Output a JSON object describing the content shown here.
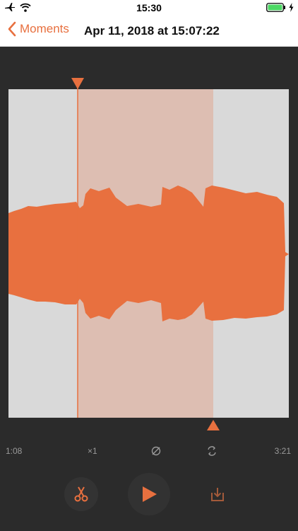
{
  "status": {
    "time": "15:30"
  },
  "nav": {
    "back_label": "Moments",
    "title": "Apr 11, 2018 at 15:07:22"
  },
  "toolbar": {
    "start_time": "1:08",
    "speed": "×1",
    "end_time": "3:21"
  },
  "colors": {
    "accent": "#e8703f",
    "background": "#2b2b2b",
    "track": "#d9d9d9",
    "selection": "#ddbeb2"
  },
  "icons": {
    "status_left": [
      "airplane-icon",
      "wifi-icon"
    ],
    "status_right": [
      "battery-icon",
      "charging-icon"
    ],
    "back": "chevron-left-icon",
    "toolbar": [
      "bounce-icon",
      "loop-icon"
    ],
    "controls": [
      "scissors-icon",
      "play-icon",
      "download-icon"
    ]
  }
}
